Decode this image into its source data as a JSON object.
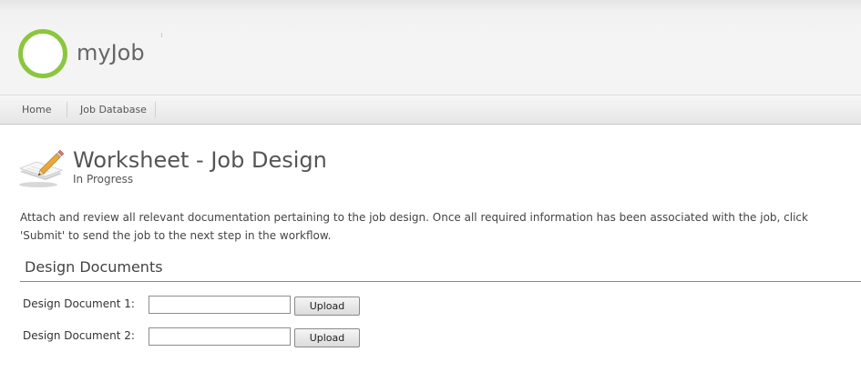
{
  "header": {
    "logo_text": "myJob",
    "brand_color": "#8cc63f"
  },
  "nav": {
    "items": [
      {
        "label": "Home"
      },
      {
        "label": "Job Database"
      }
    ]
  },
  "page": {
    "icon": "notepad-pencil-icon",
    "title": "Worksheet - Job Design",
    "status": "In Progress",
    "description": "Attach and review all relevant documentation pertaining to the job design. Once all required information has been associated with the job, click 'Submit' to send the job to the next step in the workflow."
  },
  "section": {
    "title": "Design Documents",
    "fields": [
      {
        "label": "Design Document 1:",
        "value": "",
        "button_label": "Upload"
      },
      {
        "label": "Design Document 2:",
        "value": "",
        "button_label": "Upload"
      }
    ]
  }
}
